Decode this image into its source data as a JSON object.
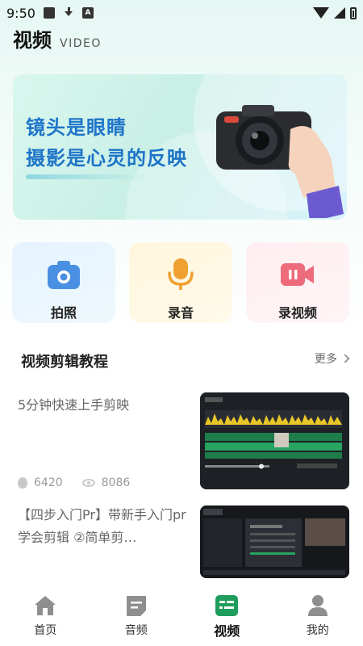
{
  "status_bar": {
    "time": "9:50"
  },
  "header": {
    "title": "视频",
    "subtitle": "VIDEO"
  },
  "banner": {
    "line1": "镜头是眼睛",
    "line2": "摄影是心灵的反映"
  },
  "quick_actions": [
    {
      "label": "拍照",
      "icon": "camera-icon",
      "color": "#4a90e2"
    },
    {
      "label": "录音",
      "icon": "microphone-icon",
      "color": "#f0a030"
    },
    {
      "label": "录视频",
      "icon": "video-record-icon",
      "color": "#ee6b7b"
    }
  ],
  "section": {
    "title": "视频剪辑教程",
    "more": "更多"
  },
  "tutorials": [
    {
      "title": "5分钟快速上手剪映",
      "likes": "6420",
      "views": "8086"
    },
    {
      "title": "【四步入门Pr】带新手入门pr学会剪辑 ②简单剪…"
    }
  ],
  "bottom_nav": [
    {
      "label": "首页",
      "icon": "home-icon"
    },
    {
      "label": "音频",
      "icon": "audio-doc-icon"
    },
    {
      "label": "视频",
      "icon": "video-icon",
      "active": true
    },
    {
      "label": "我的",
      "icon": "profile-icon"
    }
  ],
  "colors": {
    "accent": "#1f9d5c",
    "banner_text": "#1e74c8"
  }
}
